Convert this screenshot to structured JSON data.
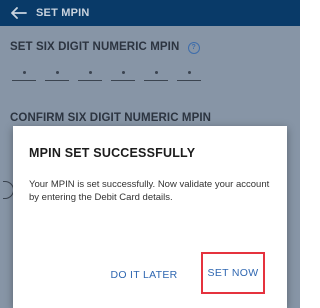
{
  "app_bar": {
    "back_icon": "arrow-left-icon",
    "title": "SET MPIN"
  },
  "form": {
    "set_label": "SET SIX DIGIT NUMERIC MPIN",
    "info_icon": "info-circle-icon",
    "info_glyph": "?",
    "pin_boxes": 6,
    "confirm_label": "CONFIRM SIX DIGIT NUMERIC MPIN"
  },
  "dialog": {
    "title": "MPIN SET SUCCESSFULLY",
    "message": "Your MPIN is set successfully. Now validate your account by entering the Debit Card details.",
    "buttons": {
      "later": "DO IT LATER",
      "set_now": "SET NOW"
    },
    "highlight_color": "#e5323e"
  },
  "colors": {
    "accent": "#2f67b1",
    "app_bar": "#0f5ea8"
  }
}
